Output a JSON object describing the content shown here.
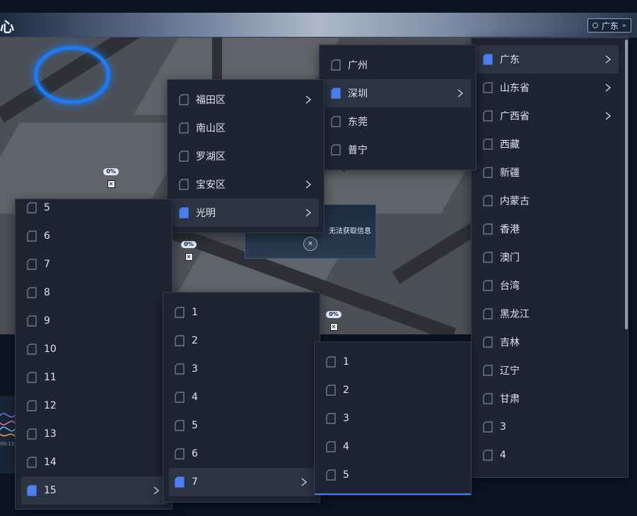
{
  "header": {
    "title": "心",
    "region_selector": {
      "label": "广东",
      "chevron": "»"
    }
  },
  "map": {
    "markers": [
      {
        "percent": "0%",
        "x_mark": "✕"
      },
      {
        "percent": "0%",
        "x_mark": "✕"
      },
      {
        "percent": "0%",
        "x_mark": "✕"
      }
    ],
    "popup": {
      "message": "无法获取信息",
      "close_label": "×"
    }
  },
  "chart_stub": {
    "time_tick": "00:12"
  },
  "dropdowns": {
    "provinces": {
      "items": [
        {
          "label": "广东",
          "active": true,
          "has_children": true
        },
        {
          "label": "山东省",
          "has_children": true
        },
        {
          "label": "广西省",
          "has_children": true
        },
        {
          "label": "西藏"
        },
        {
          "label": "新疆"
        },
        {
          "label": "内蒙古"
        },
        {
          "label": "香港"
        },
        {
          "label": "澳门"
        },
        {
          "label": "台湾"
        },
        {
          "label": "黑龙江"
        },
        {
          "label": "吉林"
        },
        {
          "label": "辽宁"
        },
        {
          "label": "甘肃"
        },
        {
          "label": "3"
        },
        {
          "label": "4"
        }
      ]
    },
    "cities": {
      "items": [
        {
          "label": "广州"
        },
        {
          "label": "深圳",
          "active": true,
          "has_children": true
        },
        {
          "label": "东莞"
        },
        {
          "label": "普宁"
        }
      ]
    },
    "districts": {
      "items": [
        {
          "label": "福田区",
          "has_children": true
        },
        {
          "label": "南山区"
        },
        {
          "label": "罗湖区"
        },
        {
          "label": "宝安区",
          "has_children": true
        },
        {
          "label": "光明",
          "active": true,
          "has_children": true
        }
      ]
    },
    "list_a": {
      "items": [
        {
          "label": "5"
        },
        {
          "label": "6"
        },
        {
          "label": "7"
        },
        {
          "label": "8"
        },
        {
          "label": "9"
        },
        {
          "label": "10"
        },
        {
          "label": "11"
        },
        {
          "label": "12"
        },
        {
          "label": "13"
        },
        {
          "label": "14"
        },
        {
          "label": "15",
          "active": true,
          "has_children": true
        }
      ]
    },
    "list_b": {
      "items": [
        {
          "label": "1"
        },
        {
          "label": "2"
        },
        {
          "label": "3"
        },
        {
          "label": "4"
        },
        {
          "label": "5"
        },
        {
          "label": "6"
        },
        {
          "label": "7",
          "active": true,
          "has_children": true
        }
      ]
    },
    "list_c": {
      "items": [
        {
          "label": "1"
        },
        {
          "label": "2"
        },
        {
          "label": "3"
        },
        {
          "label": "4"
        },
        {
          "label": "5"
        }
      ]
    }
  },
  "colors": {
    "accent": "#3a7bef",
    "panel_bg": "#1e2431",
    "active_item_bg": "#2c3444",
    "active_icon_fill": "#4d7ff0",
    "ring": "#1d7cf2"
  }
}
